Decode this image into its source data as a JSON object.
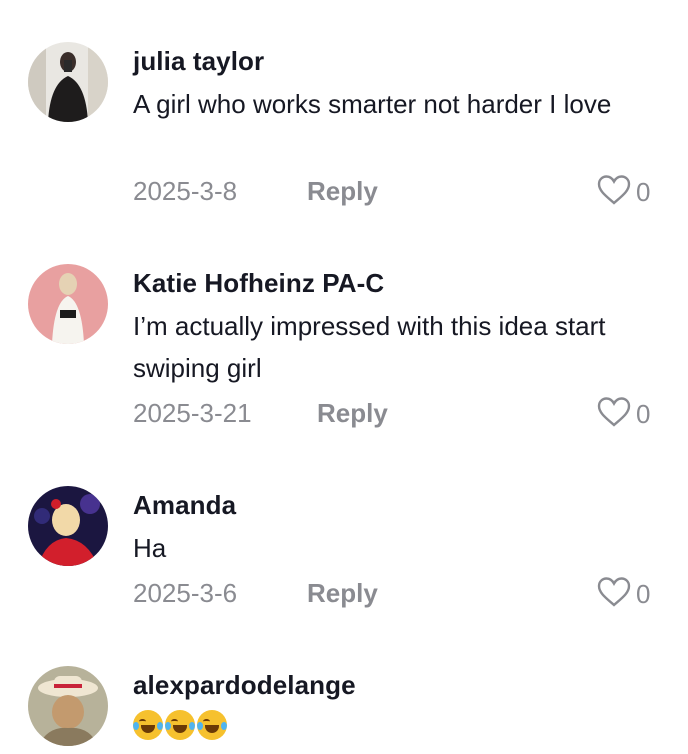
{
  "comments": [
    {
      "username": "julia taylor",
      "text": "A girl who works smarter not harder I love",
      "date": "2025-3-8",
      "reply_label": "Reply",
      "likes": "0"
    },
    {
      "username": "Katie Hofheinz PA-C",
      "text": "I’m actually impressed with this idea start swiping girl",
      "date": "2025-3-21",
      "reply_label": "Reply",
      "likes": "0"
    },
    {
      "username": "Amanda",
      "text": "Ha",
      "date": "2025-3-6",
      "reply_label": "Reply",
      "likes": "0"
    },
    {
      "username": "alexpardodelange",
      "text": "😂😂😂",
      "emoji_names": [
        "face-with-tears-of-joy",
        "face-with-tears-of-joy",
        "face-with-tears-of-joy"
      ]
    }
  ],
  "icons": {
    "like": "heart-outline-icon"
  },
  "colors": {
    "primary_text": "#161823",
    "secondary_text": "#8a8b91",
    "background": "#ffffff"
  }
}
